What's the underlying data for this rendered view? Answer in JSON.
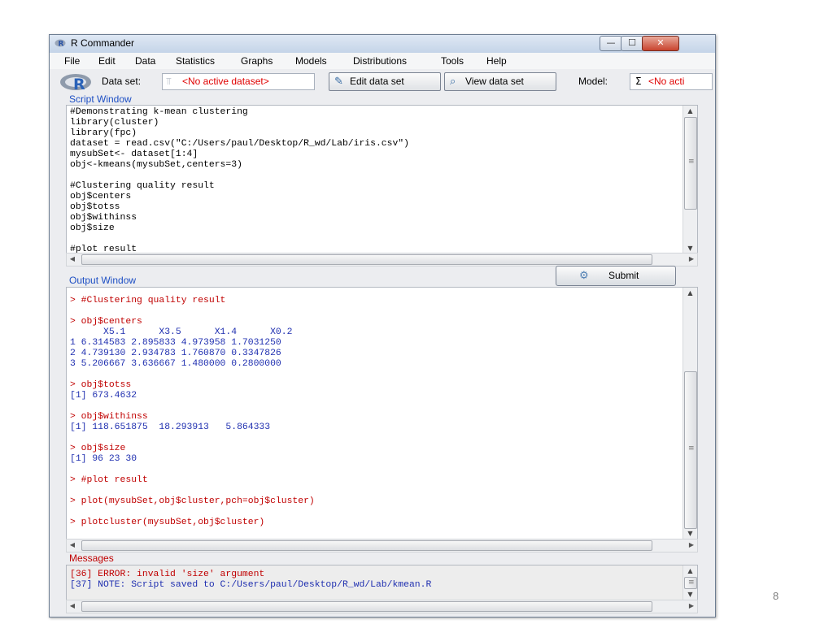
{
  "window": {
    "title": "R Commander",
    "title_icon": "r-logo-icon",
    "controls": {
      "minimize": "—",
      "maximize": "☐",
      "close": "✕"
    }
  },
  "menu": [
    "File",
    "Edit",
    "Data",
    "Statistics",
    "Graphs",
    "Models",
    "Distributions",
    "Tools",
    "Help"
  ],
  "toolbar": {
    "dataset_label": "Data set:",
    "dataset_value": "<No active dataset>",
    "edit_button": "Edit data set",
    "view_button": "View data set",
    "model_label": "Model:",
    "model_value": "<No acti"
  },
  "script": {
    "label": "Script Window",
    "lines": [
      "#Demonstrating k-mean clustering",
      "library(cluster)",
      "library(fpc)",
      "dataset = read.csv(\"C:/Users/paul/Desktop/R_wd/Lab/iris.csv\")",
      "mysubSet<- dataset[1:4]",
      "obj<-kmeans(mysubSet,centers=3)",
      "",
      "#Clustering quality result",
      "obj$centers",
      "obj$totss",
      "obj$withinss",
      "obj$size",
      "",
      "#plot result"
    ]
  },
  "submit_label": "Submit",
  "output": {
    "label": "Output Window",
    "lines": [
      {
        "t": "> #Clustering quality result",
        "c": "red"
      },
      {
        "t": "",
        "c": "black"
      },
      {
        "t": "> obj$centers",
        "c": "red"
      },
      {
        "t": "      X5.1      X3.5      X1.4      X0.2",
        "c": "blue"
      },
      {
        "t": "1 6.314583 2.895833 4.973958 1.7031250",
        "c": "blue"
      },
      {
        "t": "2 4.739130 2.934783 1.760870 0.3347826",
        "c": "blue"
      },
      {
        "t": "3 5.206667 3.636667 1.480000 0.2800000",
        "c": "blue"
      },
      {
        "t": "",
        "c": "black"
      },
      {
        "t": "> obj$totss",
        "c": "red"
      },
      {
        "t": "[1] 673.4632",
        "c": "blue"
      },
      {
        "t": "",
        "c": "black"
      },
      {
        "t": "> obj$withinss",
        "c": "red"
      },
      {
        "t": "[1] 118.651875  18.293913   5.864333",
        "c": "blue"
      },
      {
        "t": "",
        "c": "black"
      },
      {
        "t": "> obj$size",
        "c": "red"
      },
      {
        "t": "[1] 96 23 30",
        "c": "blue"
      },
      {
        "t": "",
        "c": "black"
      },
      {
        "t": "> #plot result",
        "c": "red"
      },
      {
        "t": "",
        "c": "black"
      },
      {
        "t": "> plot(mysubSet,obj$cluster,pch=obj$cluster)",
        "c": "red"
      },
      {
        "t": "",
        "c": "black"
      },
      {
        "t": "> plotcluster(mysubSet,obj$cluster)",
        "c": "red"
      }
    ]
  },
  "messages": {
    "label": "Messages",
    "lines": [
      {
        "t": "[36] ERROR: invalid 'size' argument",
        "c": "red"
      },
      {
        "t": "[37] NOTE: Script saved to C:/Users/paul/Desktop/R_wd/Lab/kmean.R",
        "c": "blue"
      }
    ]
  },
  "slide_number": "8",
  "colors": {
    "section_label": "#1d4fc4",
    "error": "#c00000",
    "output": "#1f2fb0",
    "dataset_warn": "#e00000"
  }
}
